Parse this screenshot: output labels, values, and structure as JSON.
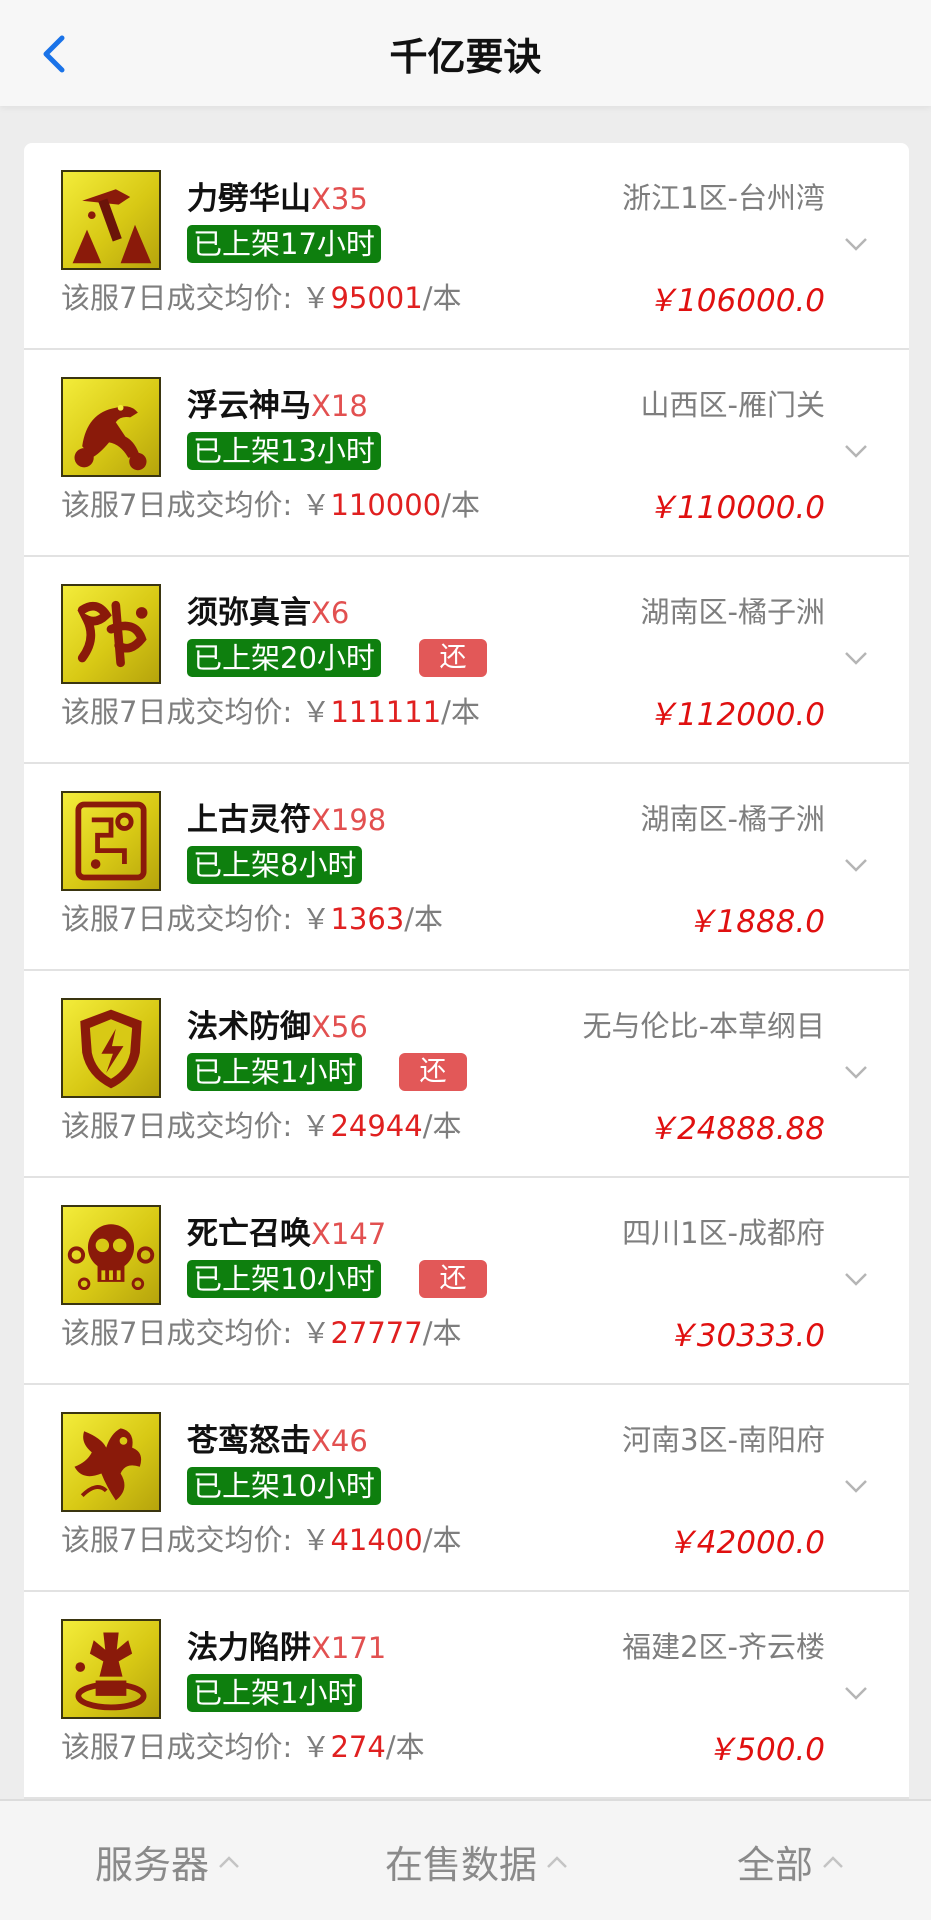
{
  "header": {
    "title": "千亿要诀"
  },
  "list": [
    {
      "icon": "pickaxe-icon",
      "name": "力劈华山",
      "qty": "X35",
      "server": "浙江1区-台州湾",
      "listed": "已上架17小时",
      "returned": false,
      "avg_label": "该服7日成交均价: ￥",
      "avg_value": "95001",
      "unit": "/本",
      "price": "￥106000.0"
    },
    {
      "icon": "cloud-horse-icon",
      "name": "浮云神马",
      "qty": "X18",
      "server": "山西区-雁门关",
      "listed": "已上架13小时",
      "returned": false,
      "avg_label": "该服7日成交均价: ￥",
      "avg_value": "110000",
      "unit": "/本",
      "price": "￥110000.0"
    },
    {
      "icon": "mantra-icon",
      "name": "须弥真言",
      "qty": "X6",
      "server": "湖南区-橘子洲",
      "listed": "已上架20小时",
      "returned": true,
      "return_label": "还",
      "avg_label": "该服7日成交均价: ￥",
      "avg_value": "111111",
      "unit": "/本",
      "price": "￥112000.0"
    },
    {
      "icon": "talisman-icon",
      "name": "上古灵符",
      "qty": "X198",
      "server": "湖南区-橘子洲",
      "listed": "已上架8小时",
      "returned": false,
      "avg_label": "该服7日成交均价: ￥",
      "avg_value": "1363",
      "unit": "/本",
      "price": "￥1888.0"
    },
    {
      "icon": "shield-lightning-icon",
      "name": "法术防御",
      "qty": "X56",
      "server": "无与伦比-本草纲目",
      "listed": "已上架1小时",
      "returned": true,
      "return_label": "还",
      "avg_label": "该服7日成交均价: ￥",
      "avg_value": "24944",
      "unit": "/本",
      "price": "￥24888.88"
    },
    {
      "icon": "skull-icon",
      "name": "死亡召唤",
      "qty": "X147",
      "server": "四川1区-成都府",
      "listed": "已上架10小时",
      "returned": true,
      "return_label": "还",
      "avg_label": "该服7日成交均价: ￥",
      "avg_value": "27777",
      "unit": "/本",
      "price": "￥30333.0"
    },
    {
      "icon": "eagle-icon",
      "name": "苍鸾怒击",
      "qty": "X46",
      "server": "河南3区-南阳府",
      "listed": "已上架10小时",
      "returned": false,
      "avg_label": "该服7日成交均价: ￥",
      "avg_value": "41400",
      "unit": "/本",
      "price": "￥42000.0"
    },
    {
      "icon": "trap-icon",
      "name": "法力陷阱",
      "qty": "X171",
      "server": "福建2区-齐云楼",
      "listed": "已上架1小时",
      "returned": false,
      "avg_label": "该服7日成交均价: ￥",
      "avg_value": "274",
      "unit": "/本",
      "price": "￥500.0"
    }
  ],
  "footer": {
    "tabs": [
      {
        "label": "服务器"
      },
      {
        "label": "在售数据"
      },
      {
        "label": "全部"
      }
    ]
  },
  "colors": {
    "accent": "#1a73e8",
    "listed_green": "#0e7f0e",
    "return_red": "#e25858",
    "price_red": "#e01010"
  }
}
